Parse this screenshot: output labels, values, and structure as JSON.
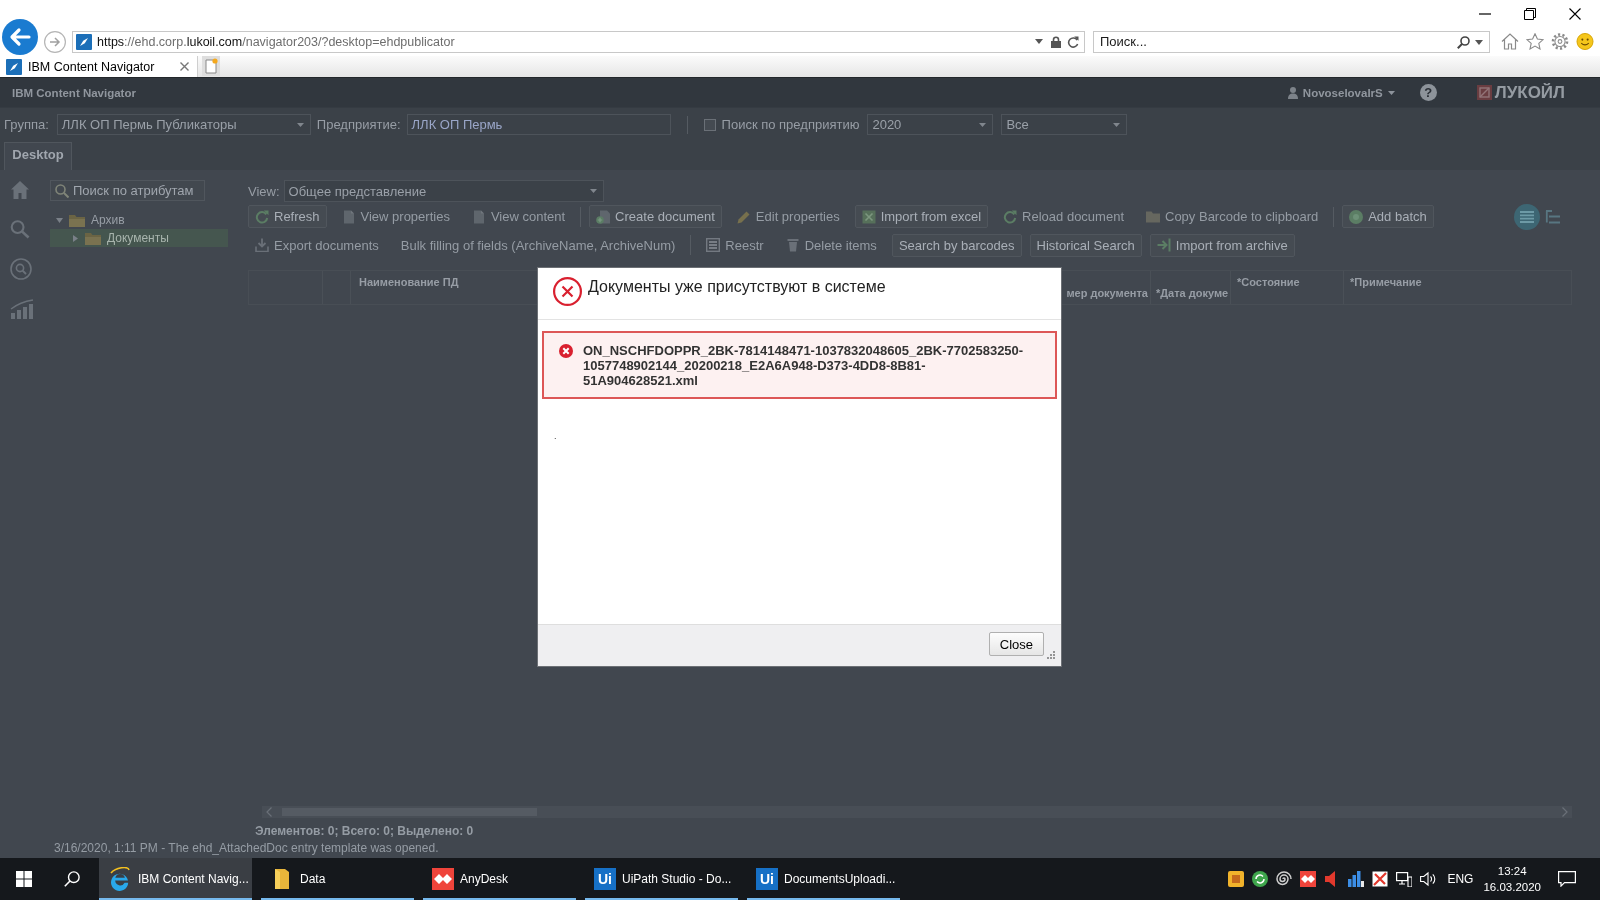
{
  "browser": {
    "address": {
      "parts": [
        {
          "text": "https",
          "emphasis": true
        },
        {
          "text": "://ehd.corp.",
          "emphasis": false
        },
        {
          "text": "lukoil.com",
          "emphasis": true
        },
        {
          "text": "/navigator203/?desktop=ehdpublicator",
          "emphasis": false
        }
      ]
    },
    "search": {
      "placeholder": "Поиск..."
    },
    "tabs": [
      {
        "label": "IBM Content Navigator",
        "selected": true
      }
    ]
  },
  "app": {
    "title": "IBM Content Navigator",
    "user": "NovoselovaIrS",
    "help": "?",
    "logo": "ЛУКОЙЛ",
    "filters": [
      {
        "kind": "select",
        "label": "Группа:",
        "value": "ЛЛК ОП Пермь Публикаторы"
      },
      {
        "kind": "input",
        "label": "Предприятие:",
        "value": "ЛЛК ОП Пермь"
      },
      {
        "kind": "checkbox",
        "label": "Поиск по предприятию",
        "checked": false
      },
      {
        "kind": "select",
        "value": "2020"
      },
      {
        "kind": "select",
        "value": "Все"
      }
    ],
    "desktop_tabs": [
      {
        "label": "Desktop",
        "selected": true
      }
    ],
    "tree": {
      "search_button": "Поиск по атрибутам",
      "items": [
        {
          "label": "Архив",
          "expanded": true,
          "selected": false,
          "children": [
            {
              "label": "Документы",
              "expanded": false,
              "selected": true
            }
          ]
        }
      ]
    },
    "view": {
      "label": "View:",
      "value": "Общее представление"
    },
    "toolbar": [
      [
        {
          "kind": "button",
          "label": "Refresh",
          "disabled": false
        },
        {
          "kind": "button",
          "label": "View properties",
          "disabled": true
        },
        {
          "kind": "button",
          "label": "View content",
          "disabled": true
        },
        {
          "kind": "separator"
        },
        {
          "kind": "button",
          "label": "Create document",
          "disabled": false
        },
        {
          "kind": "button",
          "label": "Edit properties",
          "disabled": true
        },
        {
          "kind": "button",
          "label": "Import from excel",
          "disabled": false
        },
        {
          "kind": "button",
          "label": "Reload document",
          "disabled": true
        },
        {
          "kind": "button",
          "label": "Copy Barcode to clipboard",
          "disabled": true
        },
        {
          "kind": "separator"
        },
        {
          "kind": "button",
          "label": "Add batch",
          "disabled": false
        }
      ],
      [
        {
          "kind": "button",
          "label": "Export documents",
          "disabled": true
        },
        {
          "kind": "button",
          "label": "Bulk filling of fields (ArchiveName, ArchiveNum)",
          "disabled": true
        },
        {
          "kind": "separator"
        },
        {
          "kind": "button",
          "label": "Reestr",
          "disabled": true
        },
        {
          "kind": "button",
          "label": "Delete items",
          "disabled": true
        },
        {
          "kind": "button",
          "label": "Search by barcodes",
          "disabled": false
        },
        {
          "kind": "button",
          "label": "Historical Search",
          "disabled": false
        },
        {
          "kind": "button",
          "label": "Import from archive",
          "disabled": false
        }
      ]
    ],
    "view_modes": [
      {
        "selected": true
      },
      {
        "selected": false
      }
    ],
    "table": {
      "columns": [
        "Наименование ПД",
        "мер документа",
        "*Дата докуме",
        "*Состояние",
        "*Примечание"
      ]
    },
    "status": {
      "counts": "Элементов: 0; Всего: 0; Выделено: 0",
      "message": "3/16/2020, 1:11 PM - The ehd_AttachedDoc entry template was opened."
    }
  },
  "dialog": {
    "title": "Документы уже присутствуют в системе",
    "errors": [
      "ON_NSCHFDOPPR_2BK-7814148471-1037832048605_2BK-7702583250-1057748902144_20200218_E2A6A948-D373-4DD8-8B81-51A904628521.xml"
    ],
    "note": ".",
    "buttons": [
      "Close"
    ]
  },
  "taskbar": {
    "apps": [
      {
        "kind": "browser",
        "label": "IBM Content Navig...",
        "selected": true
      },
      {
        "kind": "folder",
        "label": "Data",
        "selected": false
      },
      {
        "kind": "remote",
        "label": "AnyDesk",
        "selected": false
      },
      {
        "kind": "badge",
        "icon_text": "Ui",
        "label": "UiPath Studio - Do...",
        "selected": false
      },
      {
        "kind": "badge",
        "icon_text": "Ui",
        "label": "DocumentsUploadi...",
        "selected": false
      }
    ],
    "language": "ENG",
    "time": "13:24",
    "date": "16.03.2020"
  }
}
